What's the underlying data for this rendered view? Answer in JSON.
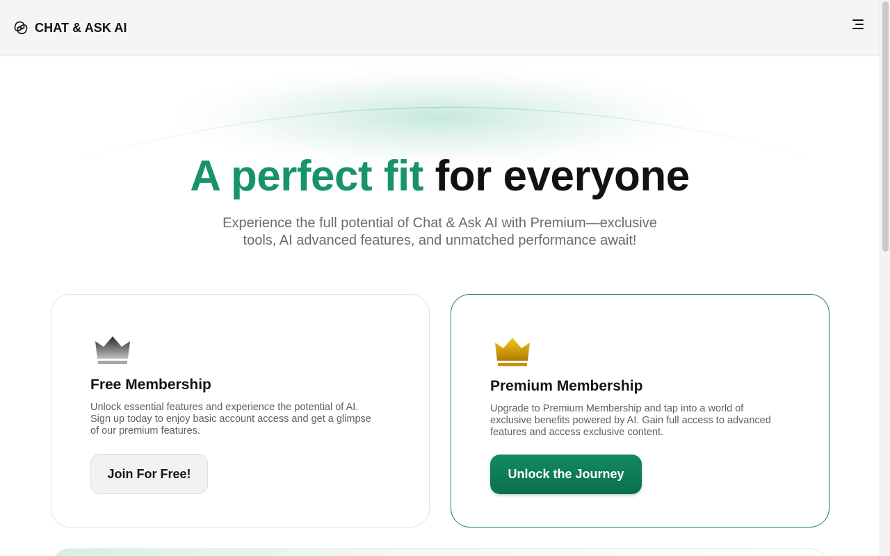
{
  "header": {
    "brand_name": "CHAT & ASK AI",
    "logo_icon": "chat-ask-ai-logo-icon",
    "menu_icon": "hamburger-menu-icon"
  },
  "hero": {
    "title_accent": "A perfect fit",
    "title_rest": "for everyone",
    "subtitle_line1": "Experience the full potential of Chat & Ask AI with Premium—exclusive",
    "subtitle_line2": "tools, AI advanced features, and unmatched performance await!"
  },
  "plans": {
    "free": {
      "icon": "crown-silver-icon",
      "title": "Free Membership",
      "desc_line1": "Unlock essential features and experience the potential of AI.",
      "desc_line2": "Sign up today to enjoy basic account access and get a glimpse",
      "desc_line3": "of our premium features.",
      "button_label": "Join For Free!"
    },
    "premium": {
      "icon": "crown-gold-icon",
      "title": "Premium Membership",
      "desc_line1": "Upgrade to Premium Membership and tap into a world of",
      "desc_line2": "exclusive benefits powered by AI. Gain full access to advanced",
      "desc_line3": "features and access exclusive content.",
      "button_label": "Unlock the Journey"
    }
  },
  "colors": {
    "accent": "#17936a",
    "button_primary": "#0f7d5a",
    "premium_border": "#1d7b5e",
    "text_dark": "#121212",
    "text_muted": "#6b6b6b"
  }
}
